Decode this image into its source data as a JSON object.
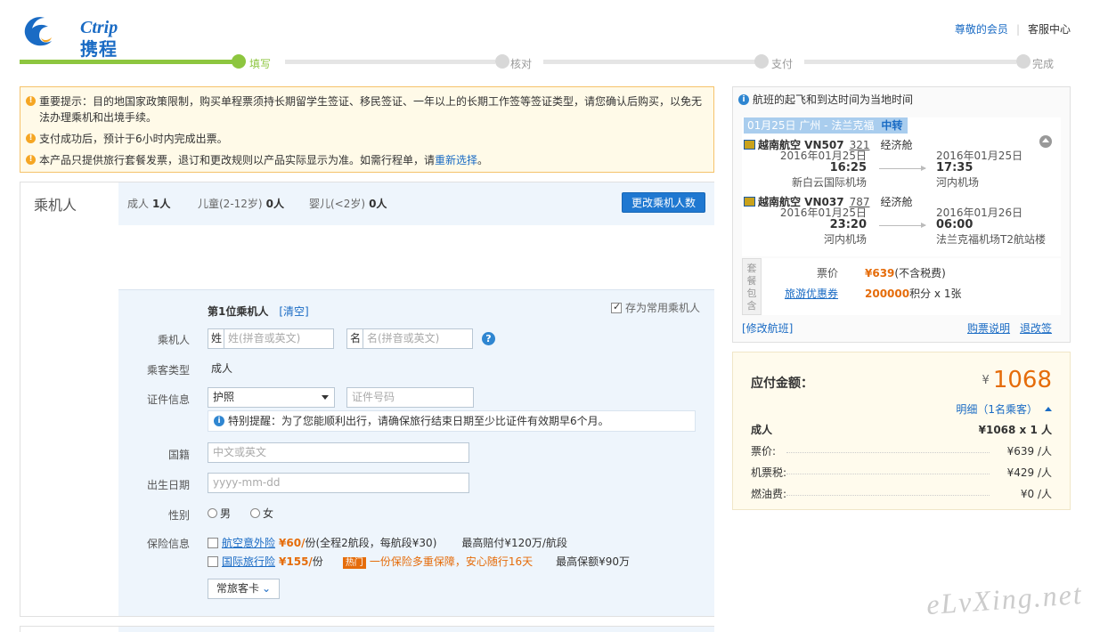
{
  "header": {
    "logo_en": "Ctrip",
    "logo_cn": "携程",
    "links": {
      "member": "尊敬的会员",
      "service": "客服中心"
    }
  },
  "progress": {
    "steps": [
      "填写",
      "核对",
      "支付",
      "完成"
    ],
    "current": 0
  },
  "notice": {
    "items": [
      "重要提示：目的地国家政策限制，购买单程票须持长期留学生签证、移民签证、一年以上的长期工作签等签证类型，请您确认后购买，以免无法办理乘机和出境手续。",
      "支付成功后，预计于6小时内完成出票。"
    ],
    "last_prefix": "本产品只提供旅行套餐发票，退订和更改规则以产品实际显示为准。如需行程单，请",
    "last_link": "重新选择",
    "last_suffix": "。"
  },
  "passenger": {
    "title": "乘机人",
    "counts": {
      "adult_label": "成人",
      "adult_value": "1人",
      "child_label": "儿童(2-12岁)",
      "child_value": "0人",
      "infant_label": "婴儿(<2岁)",
      "infant_value": "0人"
    },
    "change_button": "更改乘机人数",
    "form": {
      "heading": "第1位乘机人",
      "clear": "[清空]",
      "save_common": "存为常用乘机人",
      "name_label": "乘机人",
      "surname_prefix": "姓",
      "surname_placeholder": "姓(拼音或英文)",
      "given_prefix": "名",
      "given_placeholder": "名(拼音或英文)",
      "help": "?",
      "type_label": "乘客类型",
      "type_value": "成人",
      "id_label": "证件信息",
      "id_type": "护照",
      "id_placeholder": "证件号码",
      "tip": "特别提醒：为了您能顺利出行，请确保旅行结束日期至少比证件有效期早6个月。",
      "nationality_label": "国籍",
      "nationality_placeholder": "中文或英文",
      "birth_label": "出生日期",
      "birth_placeholder": "yyyy-mm-dd",
      "gender_label": "性别",
      "gender_male": "男",
      "gender_female": "女",
      "insurance_label": "保险信息",
      "insurance": [
        {
          "name": "航空意外险",
          "price": "¥60/",
          "unit": "份",
          "note": "(全程2航段，每航段¥30)",
          "max": "最高赔付¥120万/航段"
        },
        {
          "name": "国际旅行险",
          "price": "¥155/",
          "unit": "份",
          "hot": "热门",
          "promo": "一份保险多重保障，安心随行16天",
          "max": "最高保额¥90万"
        }
      ],
      "frequent_button": "常旅客卡"
    }
  },
  "flight": {
    "header": "航班的起飞和到达时间为当地时间",
    "route_tag": "01月25日 广州 - 法兰克福",
    "transfer": "中转",
    "segments": [
      {
        "airline": "越南航空 VN507",
        "aircraft": "321",
        "cabin": "经济舱",
        "dep_date": "2016年01月25日",
        "dep_time": "16:25",
        "dep_airport": "新白云国际机场",
        "arr_date": "2016年01月25日",
        "arr_time": "17:35",
        "arr_airport": "河内机场"
      },
      {
        "airline": "越南航空 VN037",
        "aircraft": "787",
        "cabin": "经济舱",
        "dep_date": "2016年01月25日",
        "dep_time": "23:20",
        "dep_airport": "河内机场",
        "arr_date": "2016年01月26日",
        "arr_time": "06:00",
        "arr_airport": "法兰克福机场T2航站楼"
      }
    ],
    "package_side": "套餐包含",
    "fare_label": "票价",
    "fare_value": "¥639",
    "fare_note": "(不含税费)",
    "voucher_label": "旅游优惠券",
    "voucher_value": "200000",
    "voucher_note": "积分 x 1张",
    "modify": "[修改航班]",
    "purchase_info": "购票说明",
    "refund": "退改签"
  },
  "price": {
    "due_label": "应付金额：",
    "currency": "¥",
    "due_amount": "1068",
    "detail": "明细（1名乘客）",
    "rows": [
      {
        "label": "成人",
        "value": "¥1068 x 1 人"
      },
      {
        "label": "票价:",
        "value": "¥639 /人"
      },
      {
        "label": "机票税:",
        "value": "¥429 /人"
      },
      {
        "label": "燃油费:",
        "value": "¥0 /人"
      }
    ]
  },
  "watermark": "eLvXing.net",
  "colors": {
    "accent": "#1f78d1",
    "progress": "#8dc63f",
    "price": "#e56c0a",
    "notice_border": "#f5c36b"
  }
}
